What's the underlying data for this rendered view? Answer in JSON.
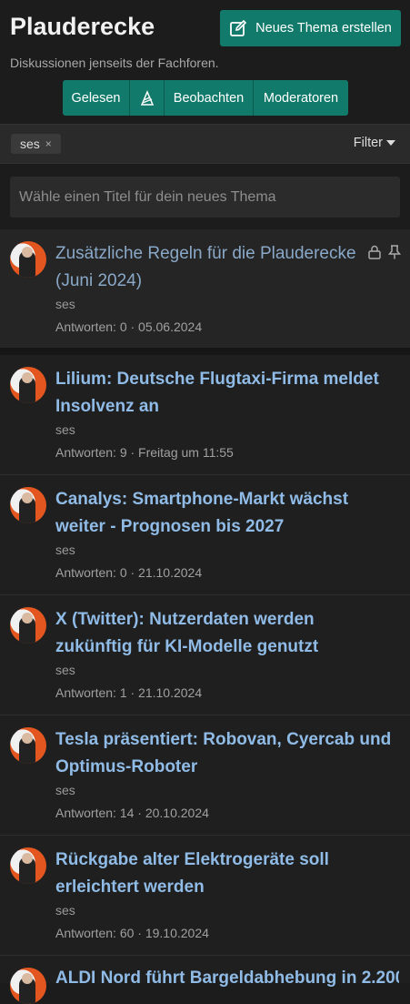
{
  "header": {
    "title": "Plauderecke",
    "subtitle": "Diskussionen jenseits der Fachforen.",
    "new_thread": "Neues Thema erstellen",
    "buttons": [
      "Gelesen",
      "Beobachten",
      "Moderatoren"
    ]
  },
  "filter": {
    "chip": "ses",
    "chip_remove": "×",
    "label": "Filter"
  },
  "quick_thread": {
    "placeholder": "Wähle einen Titel für dein neues Thema"
  },
  "sticky": {
    "title": "Zusätzliche Regeln für die Plauderecke (Juni 2024)",
    "author": "ses",
    "meta": "Antworten: 0 · 05.06.2024"
  },
  "threads": [
    {
      "title": "Lilium: Deutsche Flugtaxi-Firma meldet Insolvenz an",
      "author": "ses",
      "meta": "Antworten: 9 · Freitag um 11:55"
    },
    {
      "title": "Canalys: Smartphone-Markt wächst weiter - Prognosen bis 2027",
      "author": "ses",
      "meta": "Antworten: 0 · 21.10.2024"
    },
    {
      "title": "X (Twitter): Nutzerdaten werden zukünftig für KI-Modelle genutzt",
      "author": "ses",
      "meta": "Antworten: 1 · 21.10.2024"
    },
    {
      "title": "Tesla präsentiert: Robovan, Cyercab und Optimus-Roboter",
      "author": "ses",
      "meta": "Antworten: 14 · 20.10.2024"
    },
    {
      "title": "Rückgabe alter Elektrogeräte soll erleichtert werden",
      "author": "ses",
      "meta": "Antworten: 60 · 19.10.2024"
    },
    {
      "title": "ALDI Nord führt Bargeldabhebung in 2.200",
      "author": "",
      "meta": ""
    }
  ]
}
